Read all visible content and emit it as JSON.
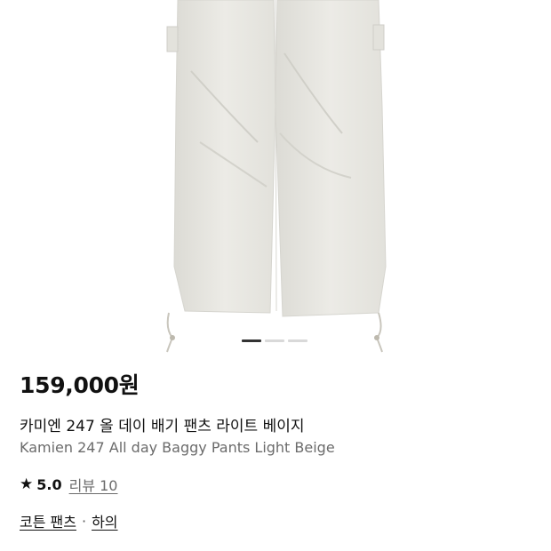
{
  "carousel": {
    "total_slides": 3,
    "active_index": 0
  },
  "product": {
    "price": "159,000원",
    "name_ko": "카미엔 247 올 데이 배기 팬츠 라이트 베이지",
    "name_en": "Kamien 247 All day Baggy Pants Light Beige",
    "rating": "5.0",
    "review_link": "리뷰 10"
  },
  "breadcrumb": {
    "category": "코튼 팬츠",
    "separator": "·",
    "parent": "하의"
  },
  "icons": {
    "rating": "star-icon"
  },
  "colors": {
    "pants": "#e9e8e3",
    "text": "#111111",
    "muted": "#6b6b6b"
  }
}
